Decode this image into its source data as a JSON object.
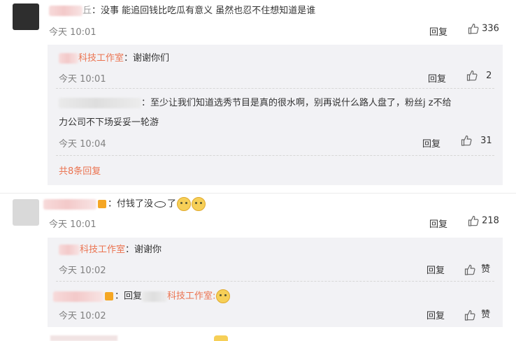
{
  "comments": [
    {
      "sep": "：",
      "text": "没事 能追回钱比吃瓜有意义 虽然也忍不住想知道是谁",
      "time": "今天 10:01",
      "reply_label": "回复",
      "likes": "336",
      "sub": [
        {
          "name": "科技工作室",
          "sep": "：",
          "text": "谢谢你们",
          "time": "今天 10:01",
          "reply_label": "回复",
          "likes": "2"
        },
        {
          "sep": "：",
          "text_line1": "至少让我们知道选秀节目是真的很水啊，别再说什么路人盘了，粉丝j z不给",
          "text_line2": "力公司不下场妥妥一轮游",
          "time": "今天 10:04",
          "reply_label": "回复",
          "likes": "31"
        }
      ],
      "more_label": "共8条回复"
    },
    {
      "sep": "：",
      "text_a": "付钱了没",
      "text_b": "了",
      "time": "今天 10:01",
      "reply_label": "回复",
      "likes": "218",
      "sub": [
        {
          "name": "科技工作室",
          "sep": "：",
          "text": "谢谢你",
          "time": "今天 10:02",
          "reply_label": "回复",
          "likes": "赞"
        },
        {
          "sep": "：",
          "reply_prefix": "回复",
          "reply_name": "科技工作室",
          "reply_sep": ":",
          "time": "今天 10:02",
          "reply_label": "回复",
          "likes": "赞"
        }
      ]
    }
  ],
  "icons": {
    "like": "thumb-up-icon"
  },
  "colors": {
    "name": "#eb7350",
    "time": "#808080",
    "panel": "#f2f2f5"
  }
}
